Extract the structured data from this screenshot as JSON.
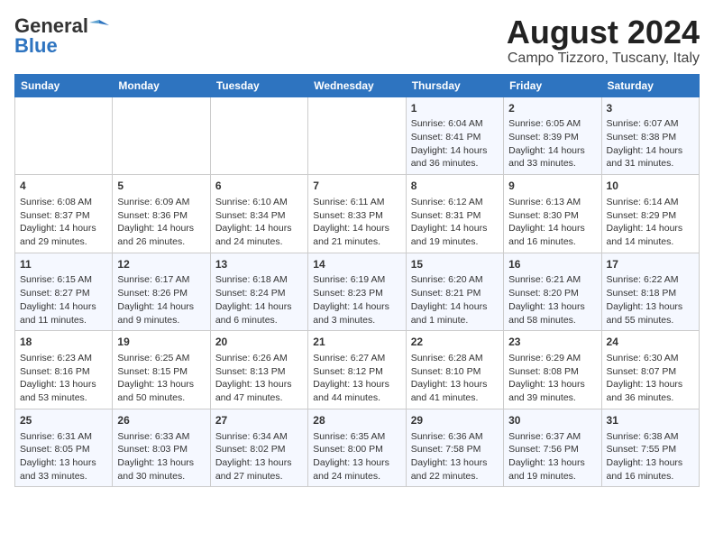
{
  "logo": {
    "general": "General",
    "blue": "Blue"
  },
  "title": "August 2024",
  "location": "Campo Tizzoro, Tuscany, Italy",
  "days_of_week": [
    "Sunday",
    "Monday",
    "Tuesday",
    "Wednesday",
    "Thursday",
    "Friday",
    "Saturday"
  ],
  "weeks": [
    [
      {
        "day": "",
        "text": ""
      },
      {
        "day": "",
        "text": ""
      },
      {
        "day": "",
        "text": ""
      },
      {
        "day": "",
        "text": ""
      },
      {
        "day": "1",
        "text": "Sunrise: 6:04 AM\nSunset: 8:41 PM\nDaylight: 14 hours and 36 minutes."
      },
      {
        "day": "2",
        "text": "Sunrise: 6:05 AM\nSunset: 8:39 PM\nDaylight: 14 hours and 33 minutes."
      },
      {
        "day": "3",
        "text": "Sunrise: 6:07 AM\nSunset: 8:38 PM\nDaylight: 14 hours and 31 minutes."
      }
    ],
    [
      {
        "day": "4",
        "text": "Sunrise: 6:08 AM\nSunset: 8:37 PM\nDaylight: 14 hours and 29 minutes."
      },
      {
        "day": "5",
        "text": "Sunrise: 6:09 AM\nSunset: 8:36 PM\nDaylight: 14 hours and 26 minutes."
      },
      {
        "day": "6",
        "text": "Sunrise: 6:10 AM\nSunset: 8:34 PM\nDaylight: 14 hours and 24 minutes."
      },
      {
        "day": "7",
        "text": "Sunrise: 6:11 AM\nSunset: 8:33 PM\nDaylight: 14 hours and 21 minutes."
      },
      {
        "day": "8",
        "text": "Sunrise: 6:12 AM\nSunset: 8:31 PM\nDaylight: 14 hours and 19 minutes."
      },
      {
        "day": "9",
        "text": "Sunrise: 6:13 AM\nSunset: 8:30 PM\nDaylight: 14 hours and 16 minutes."
      },
      {
        "day": "10",
        "text": "Sunrise: 6:14 AM\nSunset: 8:29 PM\nDaylight: 14 hours and 14 minutes."
      }
    ],
    [
      {
        "day": "11",
        "text": "Sunrise: 6:15 AM\nSunset: 8:27 PM\nDaylight: 14 hours and 11 minutes."
      },
      {
        "day": "12",
        "text": "Sunrise: 6:17 AM\nSunset: 8:26 PM\nDaylight: 14 hours and 9 minutes."
      },
      {
        "day": "13",
        "text": "Sunrise: 6:18 AM\nSunset: 8:24 PM\nDaylight: 14 hours and 6 minutes."
      },
      {
        "day": "14",
        "text": "Sunrise: 6:19 AM\nSunset: 8:23 PM\nDaylight: 14 hours and 3 minutes."
      },
      {
        "day": "15",
        "text": "Sunrise: 6:20 AM\nSunset: 8:21 PM\nDaylight: 14 hours and 1 minute."
      },
      {
        "day": "16",
        "text": "Sunrise: 6:21 AM\nSunset: 8:20 PM\nDaylight: 13 hours and 58 minutes."
      },
      {
        "day": "17",
        "text": "Sunrise: 6:22 AM\nSunset: 8:18 PM\nDaylight: 13 hours and 55 minutes."
      }
    ],
    [
      {
        "day": "18",
        "text": "Sunrise: 6:23 AM\nSunset: 8:16 PM\nDaylight: 13 hours and 53 minutes."
      },
      {
        "day": "19",
        "text": "Sunrise: 6:25 AM\nSunset: 8:15 PM\nDaylight: 13 hours and 50 minutes."
      },
      {
        "day": "20",
        "text": "Sunrise: 6:26 AM\nSunset: 8:13 PM\nDaylight: 13 hours and 47 minutes."
      },
      {
        "day": "21",
        "text": "Sunrise: 6:27 AM\nSunset: 8:12 PM\nDaylight: 13 hours and 44 minutes."
      },
      {
        "day": "22",
        "text": "Sunrise: 6:28 AM\nSunset: 8:10 PM\nDaylight: 13 hours and 41 minutes."
      },
      {
        "day": "23",
        "text": "Sunrise: 6:29 AM\nSunset: 8:08 PM\nDaylight: 13 hours and 39 minutes."
      },
      {
        "day": "24",
        "text": "Sunrise: 6:30 AM\nSunset: 8:07 PM\nDaylight: 13 hours and 36 minutes."
      }
    ],
    [
      {
        "day": "25",
        "text": "Sunrise: 6:31 AM\nSunset: 8:05 PM\nDaylight: 13 hours and 33 minutes."
      },
      {
        "day": "26",
        "text": "Sunrise: 6:33 AM\nSunset: 8:03 PM\nDaylight: 13 hours and 30 minutes."
      },
      {
        "day": "27",
        "text": "Sunrise: 6:34 AM\nSunset: 8:02 PM\nDaylight: 13 hours and 27 minutes."
      },
      {
        "day": "28",
        "text": "Sunrise: 6:35 AM\nSunset: 8:00 PM\nDaylight: 13 hours and 24 minutes."
      },
      {
        "day": "29",
        "text": "Sunrise: 6:36 AM\nSunset: 7:58 PM\nDaylight: 13 hours and 22 minutes."
      },
      {
        "day": "30",
        "text": "Sunrise: 6:37 AM\nSunset: 7:56 PM\nDaylight: 13 hours and 19 minutes."
      },
      {
        "day": "31",
        "text": "Sunrise: 6:38 AM\nSunset: 7:55 PM\nDaylight: 13 hours and 16 minutes."
      }
    ]
  ]
}
